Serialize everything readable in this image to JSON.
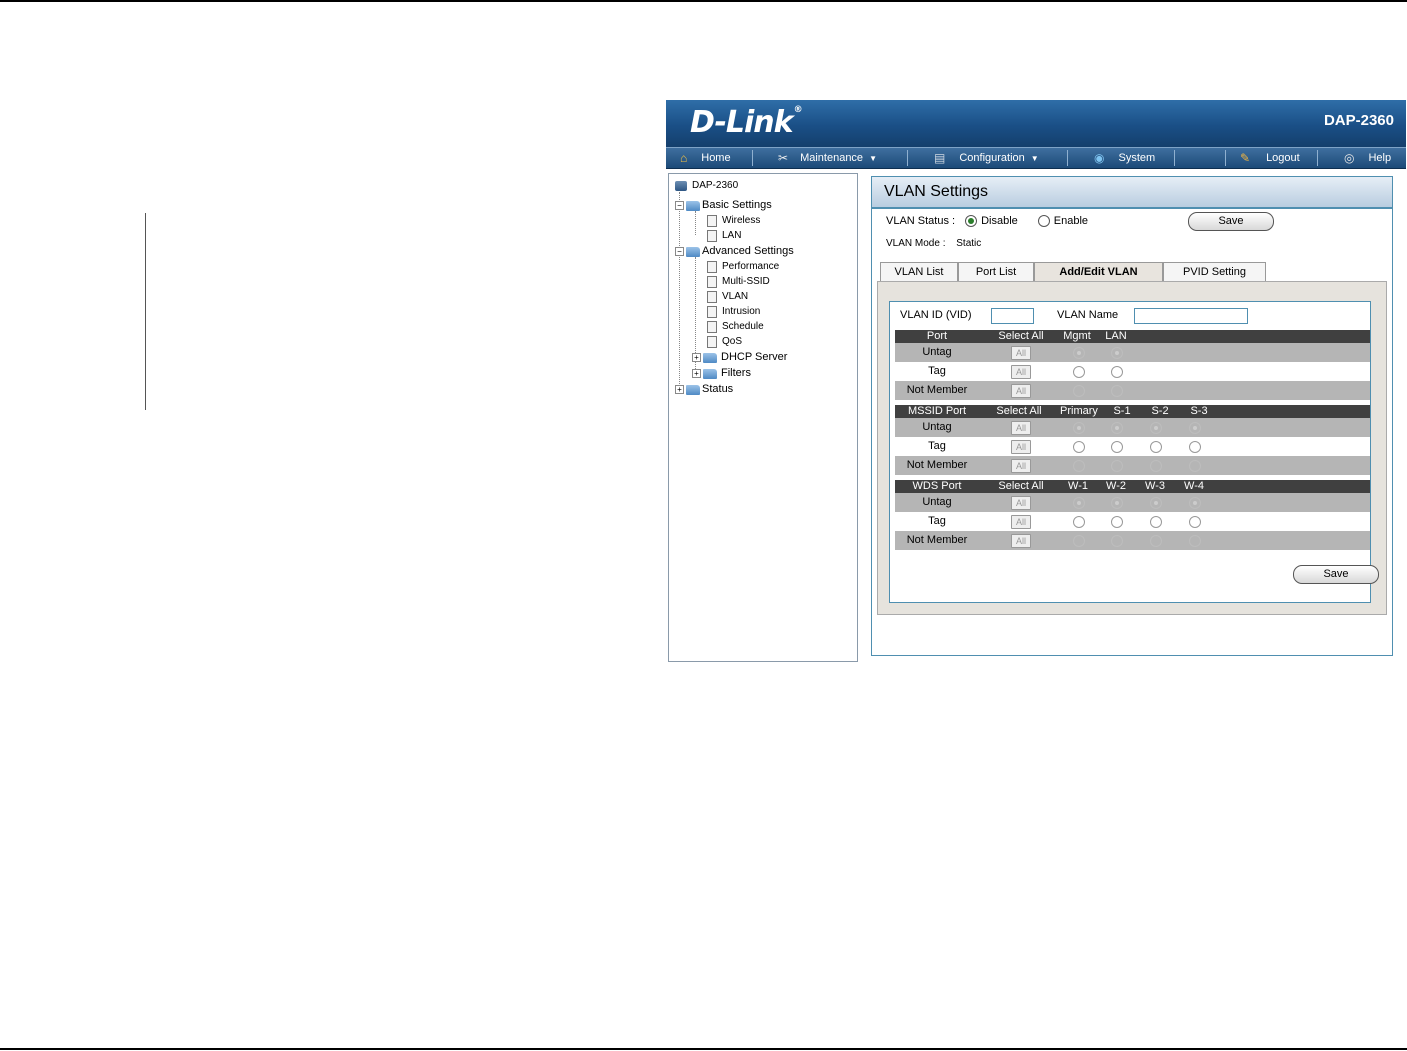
{
  "header": {
    "logo": "D-Link",
    "model": "DAP-2360"
  },
  "menu": [
    {
      "label": "Home",
      "icon": "home-icon"
    },
    {
      "label": "Maintenance",
      "icon": "tools-icon",
      "dropdown": true
    },
    {
      "label": "Configuration",
      "icon": "disk-icon",
      "dropdown": true
    },
    {
      "label": "System",
      "icon": "globe-icon"
    },
    {
      "label": "Logout",
      "icon": "key-icon"
    },
    {
      "label": "Help",
      "icon": "help-icon"
    }
  ],
  "tree": {
    "root": "DAP-2360",
    "basic": "Basic Settings",
    "basic_items": [
      "Wireless",
      "LAN"
    ],
    "advanced": "Advanced Settings",
    "advanced_items": [
      "Performance",
      "Multi-SSID",
      "VLAN",
      "Intrusion",
      "Schedule",
      "QoS"
    ],
    "dhcp": "DHCP Server",
    "filters": "Filters",
    "status": "Status"
  },
  "page": {
    "title": "VLAN Settings",
    "vlan_status_label": "VLAN Status :",
    "disable_label": "Disable",
    "enable_label": "Enable",
    "vlan_status_selected": "Disable",
    "save_label": "Save",
    "vlan_mode_label": "VLAN Mode :",
    "vlan_mode_value": "Static",
    "tabs": [
      "VLAN List",
      "Port List",
      "Add/Edit VLAN",
      "PVID Setting"
    ],
    "active_tab": "Add/Edit VLAN",
    "vlan_id_label": "VLAN ID (VID)",
    "vlan_id_value": "",
    "vlan_name_label": "VLAN Name",
    "vlan_name_value": "",
    "all_label": "All",
    "row_labels": {
      "untag": "Untag",
      "tag": "Tag",
      "not_member": "Not Member"
    },
    "select_all": "Select All",
    "port_group": {
      "title": "Port",
      "columns": [
        "Mgmt",
        "LAN"
      ]
    },
    "mssid_group": {
      "title": "MSSID Port",
      "columns": [
        "Primary",
        "S-1",
        "S-2",
        "S-3"
      ]
    },
    "wds_group": {
      "title": "WDS Port",
      "columns": [
        "W-1",
        "W-2",
        "W-3",
        "W-4"
      ]
    }
  }
}
